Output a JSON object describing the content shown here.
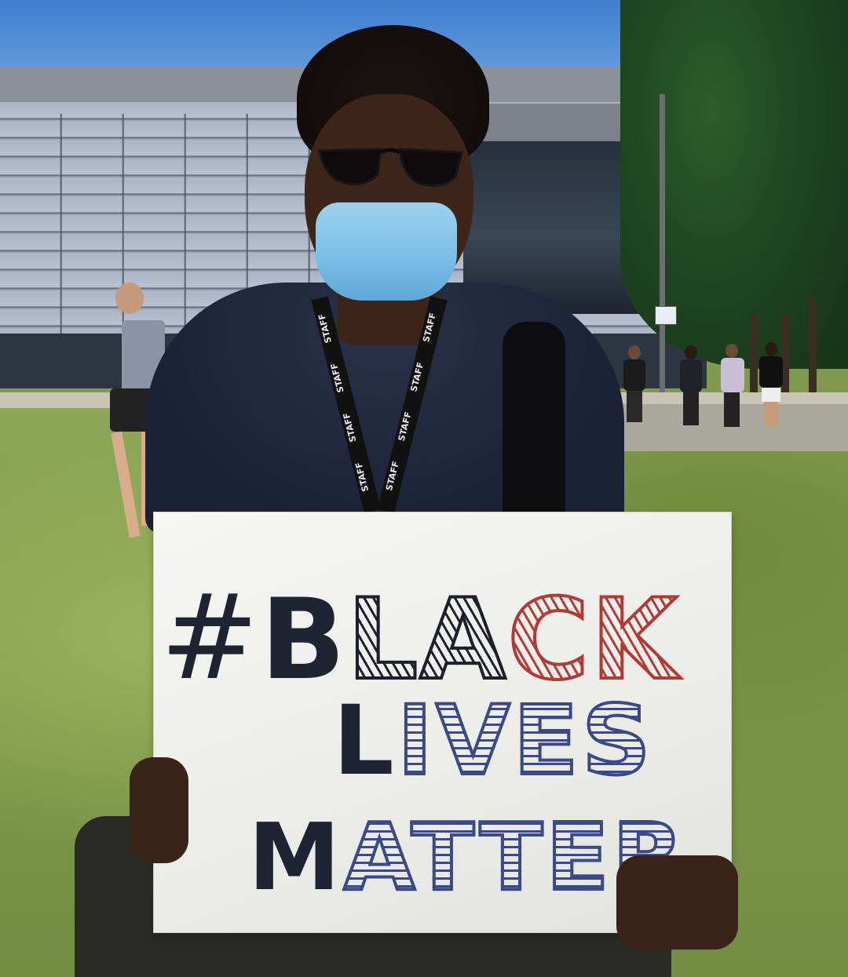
{
  "sign": {
    "line1": {
      "hash": "#",
      "b": "B",
      "la": "LA",
      "ck": "CK"
    },
    "line2": {
      "l": "L",
      "ives": "IVES"
    },
    "line3": {
      "m": "M",
      "atter": "ATTER"
    }
  },
  "lanyard_text": "STAFF",
  "colors": {
    "sign_black": "#1f2433",
    "sign_red": "#b23a36",
    "sign_blue": "#3b4a86",
    "mask": "#78bde6",
    "sky": "#4f8ed6",
    "grass": "#7f9a4c"
  }
}
